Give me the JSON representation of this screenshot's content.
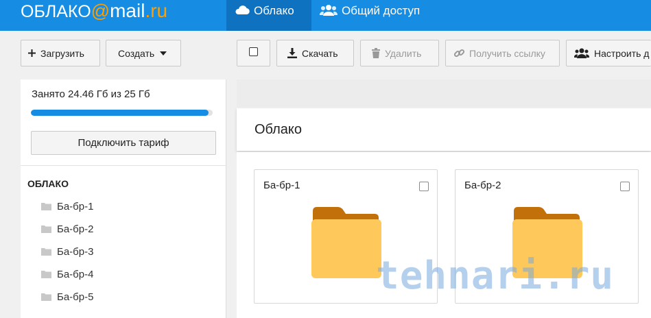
{
  "header": {
    "logo": {
      "part1": "ОБЛАКО",
      "at": "@",
      "mail": "mail",
      "ru": ".ru"
    },
    "nav": [
      {
        "label": "Облако",
        "icon": "cloud-icon"
      },
      {
        "label": "Общий доступ",
        "icon": "people-icon"
      }
    ],
    "colors": {
      "bar": "#168de2",
      "active": "#0f72c0",
      "logo_accent": "#ff9e00"
    }
  },
  "toolbar": {
    "upload": "Загрузить",
    "create": "Создать",
    "download": "Скачать",
    "delete": "Удалить",
    "get_link": "Получить ссылку",
    "configure": "Настроить д"
  },
  "quota": {
    "text": "Занято 24.46 Гб из 25 Гб",
    "used_fraction": 0.978,
    "tariff_button": "Подключить тариф"
  },
  "tree": {
    "title": "ОБЛАКО",
    "items": [
      {
        "label": "Ба-бр-1"
      },
      {
        "label": "Ба-бр-2"
      },
      {
        "label": "Ба-бр-3"
      },
      {
        "label": "Ба-бр-4"
      },
      {
        "label": "Ба-бр-5"
      }
    ]
  },
  "main": {
    "title": "Облако",
    "tiles": [
      {
        "name": "Ба-бр-1",
        "icon": "folder-icon"
      },
      {
        "name": "Ба-бр-2",
        "icon": "folder-icon"
      }
    ]
  },
  "watermark": "tehnari.ru"
}
